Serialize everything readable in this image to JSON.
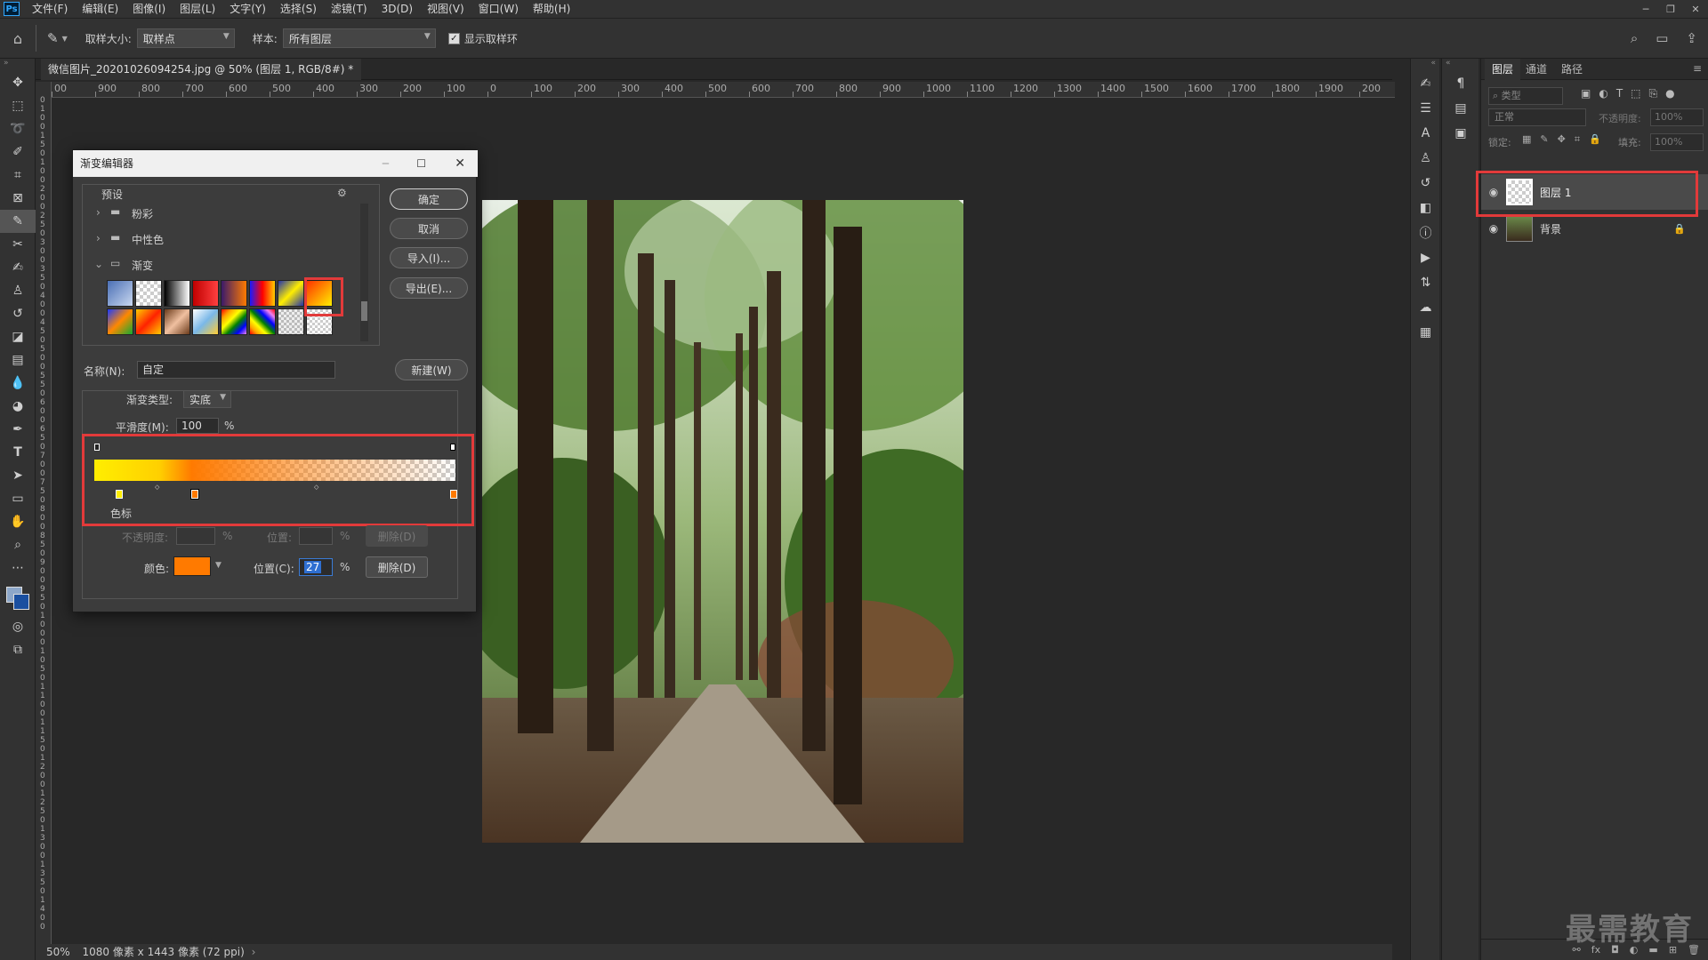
{
  "app": {
    "logo": "Ps"
  },
  "menu": [
    "文件(F)",
    "编辑(E)",
    "图像(I)",
    "图层(L)",
    "文字(Y)",
    "选择(S)",
    "滤镜(T)",
    "3D(D)",
    "视图(V)",
    "窗口(W)",
    "帮助(H)"
  ],
  "options": {
    "sample_size_label": "取样大小:",
    "sample_size_value": "取样点",
    "sample_label": "样本:",
    "sample_value": "所有图层",
    "show_ring_label": "显示取样环"
  },
  "document": {
    "tab_title": "微信图片_20201026094254.jpg @ 50% (图层 1, RGB/8#) *",
    "ruler_h": [
      "00",
      "900",
      "800",
      "700",
      "600",
      "500",
      "400",
      "300",
      "200",
      "100",
      "0",
      "100",
      "200",
      "300",
      "400",
      "500",
      "600",
      "700",
      "800",
      "900",
      "1000",
      "1100",
      "1200",
      "1300",
      "1400",
      "1500",
      "1600",
      "1700",
      "1800",
      "1900",
      "200"
    ],
    "ruler_v": [
      "0",
      "1",
      "0",
      "0",
      "1",
      "5",
      "0",
      "1",
      "0",
      "0",
      "2",
      "0",
      "0",
      "2",
      "5",
      "0",
      "3",
      "0",
      "0",
      "3",
      "5",
      "0",
      "4",
      "0",
      "0",
      "4",
      "5",
      "0",
      "5",
      "0",
      "0",
      "5",
      "5",
      "0",
      "6",
      "0",
      "0",
      "6",
      "5",
      "0",
      "7",
      "0",
      "0",
      "7",
      "5",
      "0",
      "8",
      "0",
      "0",
      "8",
      "5",
      "0",
      "9",
      "0",
      "0",
      "9",
      "5",
      "0",
      "1",
      "0",
      "0",
      "0",
      "1",
      "0",
      "5",
      "0",
      "1",
      "1",
      "0",
      "0",
      "1",
      "1",
      "5",
      "0",
      "1",
      "2",
      "0",
      "0",
      "1",
      "2",
      "5",
      "0",
      "1",
      "3",
      "0",
      "0",
      "1",
      "3",
      "5",
      "0",
      "1",
      "4",
      "0",
      "0"
    ]
  },
  "status": {
    "zoom": "50%",
    "info": "1080 像素 x 1443 像素 (72 ppi)"
  },
  "dialog": {
    "title": "渐变编辑器",
    "presets_label": "预设",
    "folders": [
      "粉彩",
      "中性色",
      "渐变"
    ],
    "buttons": {
      "ok": "确定",
      "cancel": "取消",
      "import": "导入(I)...",
      "export": "导出(E)...",
      "new": "新建(W)"
    },
    "name_label": "名称(N):",
    "name_value": "自定",
    "type_label": "渐变类型:",
    "type_value": "实底",
    "smooth_label": "平滑度(M):",
    "smooth_value": "100",
    "percent": "%",
    "stops_label": "色标",
    "opacity_label": "不透明度:",
    "position_label_1": "位置:",
    "delete_label_1": "删除(D)",
    "color_label": "颜色:",
    "position_label_2": "位置(C):",
    "position_value": "27",
    "delete_label_2": "删除(D)",
    "selected_color": "#ff7a00"
  },
  "layers_panel": {
    "tabs": [
      "图层",
      "通道",
      "路径"
    ],
    "search_placeholder": "类型",
    "blend_mode": "正常",
    "opacity_label": "不透明度:",
    "opacity_value": "100%",
    "lock_label": "锁定:",
    "fill_label": "填充:",
    "fill_value": "100%",
    "layers": [
      {
        "name": "图层 1",
        "selected": true
      },
      {
        "name": "背景",
        "locked": true
      }
    ]
  },
  "watermark": "最需教育"
}
